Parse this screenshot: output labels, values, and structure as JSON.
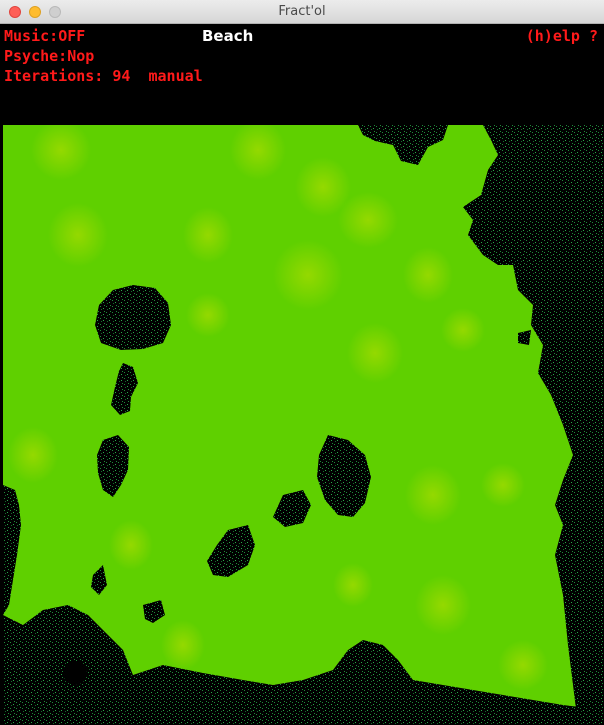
{
  "window": {
    "title": "Fract'ol"
  },
  "hud": {
    "music_label": "Music:",
    "music_value": "OFF",
    "psyche_label": "Psyche:",
    "psyche_value": "Nop",
    "iterations_label": "Iterations:",
    "iterations_value": "94",
    "mode": "manual",
    "scene": "Beach",
    "help": "(h)elp ?"
  },
  "colors": {
    "hud_text": "#ff1a1a",
    "scene_text": "#ffffff",
    "fractal_green": "#5fd400",
    "fractal_yellow_green": "#9bd800",
    "fractal_interior": "#000000"
  }
}
